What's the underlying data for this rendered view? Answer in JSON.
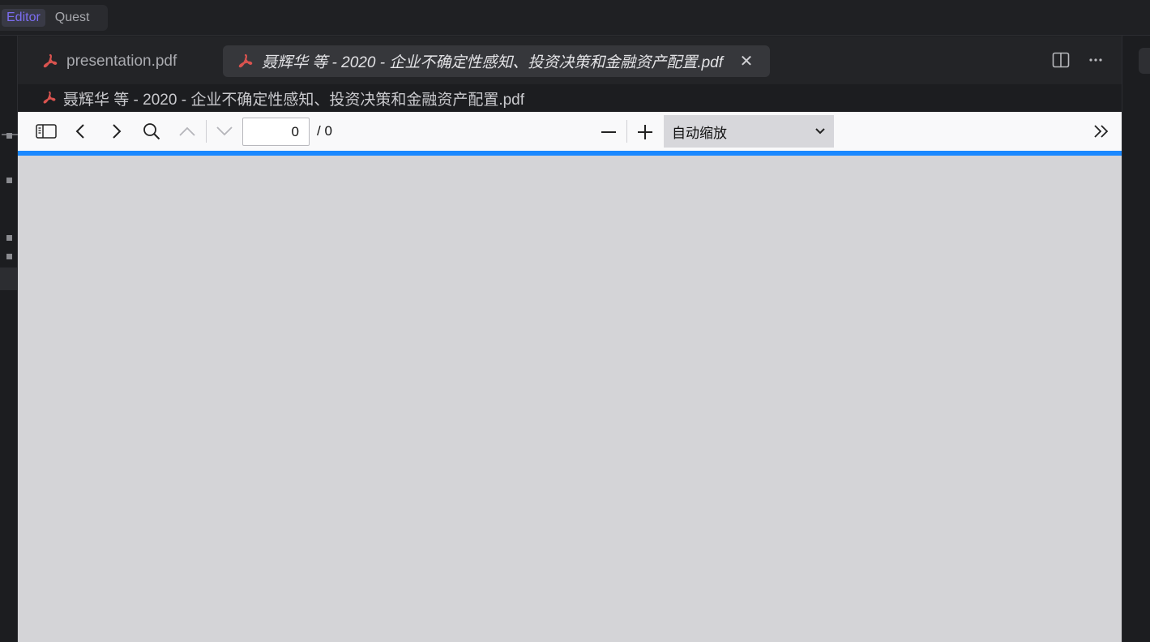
{
  "modebar": {
    "modes": [
      {
        "label": "Editor",
        "active": true
      },
      {
        "label": "Quest",
        "active": false
      }
    ]
  },
  "tabs": [
    {
      "label": "presentation.pdf",
      "icon": "pdf-icon",
      "active": false
    },
    {
      "label": "聂辉华 等 - 2020 - 企业不确定性感知、投资决策和金融资产配置.pdf",
      "icon": "pdf-icon",
      "active": true,
      "close_icon": "✕"
    }
  ],
  "breadcrumb": {
    "label": "聂辉华 等 - 2020 - 企业不确定性感知、投资决策和金融资产配置.pdf",
    "icon": "pdf-icon"
  },
  "pdf_toolbar": {
    "page_value": "0",
    "page_total": "/ 0",
    "zoom_selected": "自动缩放",
    "progress": 1.0
  },
  "colors": {
    "accent": "#7c6df2",
    "pdf_icon": "#d9534f",
    "progress": "#1a88ff",
    "viewer_bg": "#d4d4d7"
  }
}
